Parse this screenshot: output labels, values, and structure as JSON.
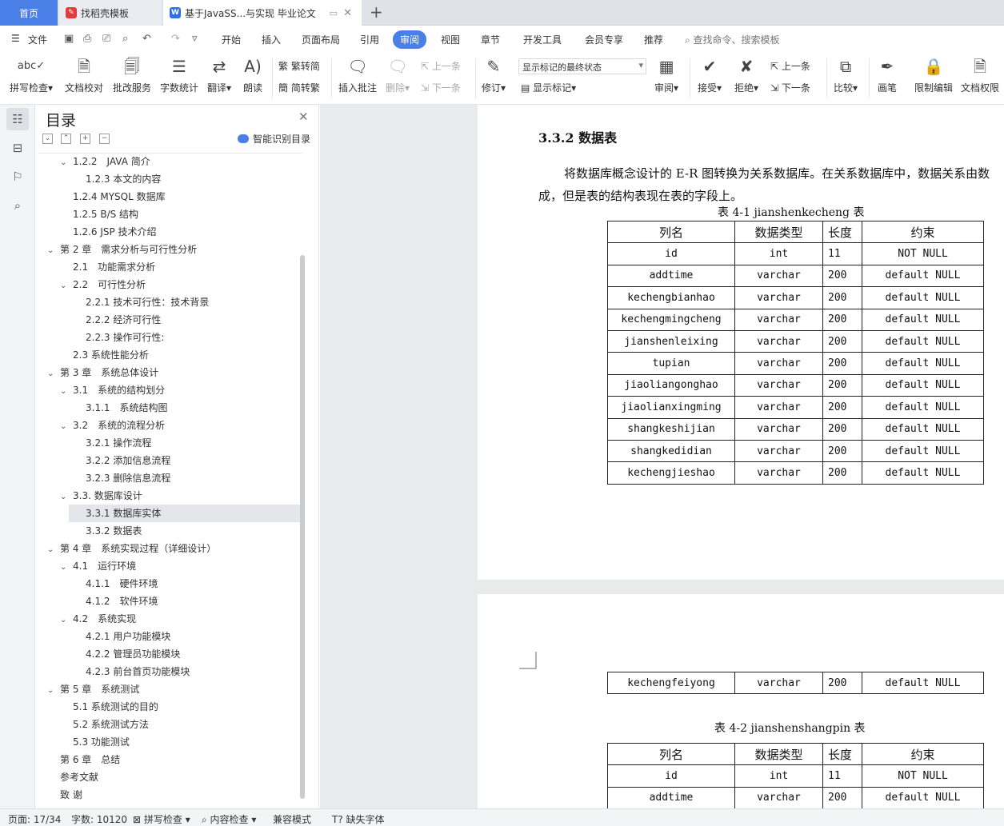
{
  "tabs": {
    "home": "首页",
    "template": "找稻壳模板",
    "doc": "基于JavaSS...与实现 毕业论文",
    "add": "+"
  },
  "menu": {
    "file": "文件",
    "items": [
      "开始",
      "插入",
      "页面布局",
      "引用",
      "审阅",
      "视图",
      "章节",
      "开发工具",
      "会员专享",
      "推荐"
    ],
    "active": "审阅",
    "search": "查找命令、搜索模板"
  },
  "ribbon": {
    "spell": "拼写检查",
    "proofread": "文档校对",
    "batch": "批改服务",
    "wordcount": "字数统计",
    "translate": "翻译",
    "read": "朗读",
    "trad": "繁转简",
    "simp": "简转繁",
    "insert_comment": "插入批注",
    "delete": "删除",
    "prev": "上一条",
    "next": "下一条",
    "track": "修订",
    "markup_state": "显示标记的最终状态",
    "show_markup": "显示标记",
    "review_pane": "审阅",
    "accept": "接受",
    "reject": "拒绝",
    "prev2": "上一条",
    "next2": "下一条",
    "compare": "比较",
    "pen": "画笔",
    "restrict": "限制编辑",
    "permission": "文档权限"
  },
  "toc": {
    "title": "目录",
    "smart": "智能识别目录",
    "items": [
      {
        "t": "1.2.2　JAVA 简介",
        "lvl": 2,
        "exp": true
      },
      {
        "t": "1.2.3  本文的内容",
        "lvl": 3
      },
      {
        "t": "1.2.4 MYSQL 数据库",
        "lvl": 2
      },
      {
        "t": "1.2.5 B/S 结构",
        "lvl": 2
      },
      {
        "t": "1.2.6 JSP 技术介绍",
        "lvl": 2
      },
      {
        "t": "第 2 章　需求分析与可行性分析",
        "lvl": 1,
        "exp": true
      },
      {
        "t": "2.1　功能需求分析",
        "lvl": 2
      },
      {
        "t": "2.2　可行性分析",
        "lvl": 2,
        "exp": true
      },
      {
        "t": "2.2.1 技术可行性：技术背景",
        "lvl": 3
      },
      {
        "t": "2.2.2 经济可行性",
        "lvl": 3
      },
      {
        "t": "2.2.3 操作可行性:",
        "lvl": 3
      },
      {
        "t": "2.3  系统性能分析",
        "lvl": 2
      },
      {
        "t": "第 3 章　系统总体设计",
        "lvl": 1,
        "exp": true
      },
      {
        "t": "3.1　系统的结构划分",
        "lvl": 2,
        "exp": true
      },
      {
        "t": "3.1.1　系统结构图",
        "lvl": 3
      },
      {
        "t": "3.2　系统的流程分析",
        "lvl": 2,
        "exp": true
      },
      {
        "t": "3.2.1 操作流程",
        "lvl": 3
      },
      {
        "t": "3.2.2 添加信息流程",
        "lvl": 3
      },
      {
        "t": "3.2.3 删除信息流程",
        "lvl": 3
      },
      {
        "t": "3.3.  数据库设计",
        "lvl": 2,
        "exp": true
      },
      {
        "t": "3.3.1  数据库实体",
        "lvl": 3,
        "sel": true
      },
      {
        "t": "3.3.2 数据表",
        "lvl": 3
      },
      {
        "t": "第 4 章　系统实现过程（详细设计）",
        "lvl": 1,
        "exp": true
      },
      {
        "t": "4.1　运行环境",
        "lvl": 2,
        "exp": true
      },
      {
        "t": "4.1.1　硬件环境",
        "lvl": 3
      },
      {
        "t": "4.1.2　软件环境",
        "lvl": 3
      },
      {
        "t": "4.2　系统实现",
        "lvl": 2,
        "exp": true
      },
      {
        "t": "4.2.1 用户功能模块",
        "lvl": 3
      },
      {
        "t": "4.2.2 管理员功能模块",
        "lvl": 3
      },
      {
        "t": "4.2.3 前台首页功能模块",
        "lvl": 3
      },
      {
        "t": "第 5 章　系统测试",
        "lvl": 1,
        "exp": true
      },
      {
        "t": "5.1 系统测试的目的",
        "lvl": 2
      },
      {
        "t": "5.2 系统测试方法",
        "lvl": 2
      },
      {
        "t": "5.3 功能测试",
        "lvl": 2
      },
      {
        "t": "第 6 章　总结",
        "lvl": 1
      },
      {
        "t": "参考文献",
        "lvl": 1
      },
      {
        "t": "致  谢",
        "lvl": 1
      }
    ]
  },
  "document": {
    "heading": "3.3.2 数据表",
    "para1": "将数据库概念设计的 E-R 图转换为关系数据库。在关系数据库中，数据关系由数",
    "para2": "成，但是表的结构表现在表的字段上。",
    "caption1": "表 4-1 jianshenkecheng 表",
    "caption2": "表 4-2 jianshenshangpin 表",
    "headers": [
      "列名",
      "数据类型",
      "长度",
      "约束"
    ],
    "table1": [
      [
        "id",
        "int",
        "11",
        "NOT NULL"
      ],
      [
        "addtime",
        "varchar",
        "200",
        "default NULL"
      ],
      [
        "kechengbianhao",
        "varchar",
        "200",
        "default NULL"
      ],
      [
        "kechengmingcheng",
        "varchar",
        "200",
        "default NULL"
      ],
      [
        "jianshenleixing",
        "varchar",
        "200",
        "default NULL"
      ],
      [
        "tupian",
        "varchar",
        "200",
        "default NULL"
      ],
      [
        "jiaoliangonghao",
        "varchar",
        "200",
        "default NULL"
      ],
      [
        "jiaolianxingming",
        "varchar",
        "200",
        "default NULL"
      ],
      [
        "shangkeshijian",
        "varchar",
        "200",
        "default NULL"
      ],
      [
        "shangkedidian",
        "varchar",
        "200",
        "default NULL"
      ],
      [
        "kechengjieshao",
        "varchar",
        "200",
        "default NULL"
      ]
    ],
    "table1_cont": [
      [
        "kechengfeiyong",
        "varchar",
        "200",
        "default NULL"
      ]
    ],
    "table2": [
      [
        "id",
        "int",
        "11",
        "NOT NULL"
      ],
      [
        "addtime",
        "varchar",
        "200",
        "default NULL"
      ]
    ]
  },
  "status": {
    "page": "页面: 17/34",
    "words": "字数: 10120",
    "spell": "拼写检查",
    "content": "内容检查",
    "compat": "兼容模式",
    "missing_font": "缺失字体"
  },
  "colors": {
    "accent": "#4a7fe8"
  }
}
